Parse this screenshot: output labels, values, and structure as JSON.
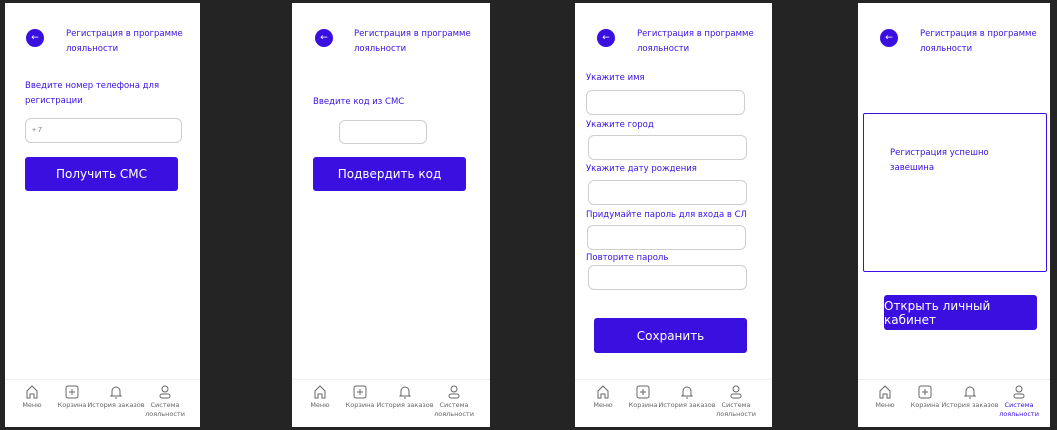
{
  "header": {
    "title": "Регистрация в программе лояльности",
    "back_icon": "arrow-left-icon"
  },
  "nav": [
    {
      "label": "Меню",
      "icon": "home-icon"
    },
    {
      "label": "Корзина",
      "icon": "plus-square-icon"
    },
    {
      "label": "История заказов",
      "icon": "bell-icon"
    },
    {
      "label": "Система лояльности",
      "icon": "user-icon"
    }
  ],
  "screen1": {
    "label": "Введите номер телефона для регистрации",
    "phone_placeholder": "+ 7",
    "button": "Получить СМС"
  },
  "screen2": {
    "label": "Введите код из СМС",
    "code_value": "",
    "button": "Подвердить код"
  },
  "screen3": {
    "fields": [
      {
        "label": "Укажите имя",
        "value": ""
      },
      {
        "label": "Укажите город",
        "value": ""
      },
      {
        "label": "Укажите дату рождения",
        "value": ""
      },
      {
        "label": "Придумайте пароль для входа в СЛ",
        "value": ""
      },
      {
        "label": "Повторите пароль",
        "value": ""
      }
    ],
    "button": "Сохранить"
  },
  "screen4": {
    "message": "Регистрация успешно завешина",
    "button": "Открыть личный кабинет"
  },
  "colors": {
    "accent": "#3a10e0",
    "background": "#242424"
  }
}
